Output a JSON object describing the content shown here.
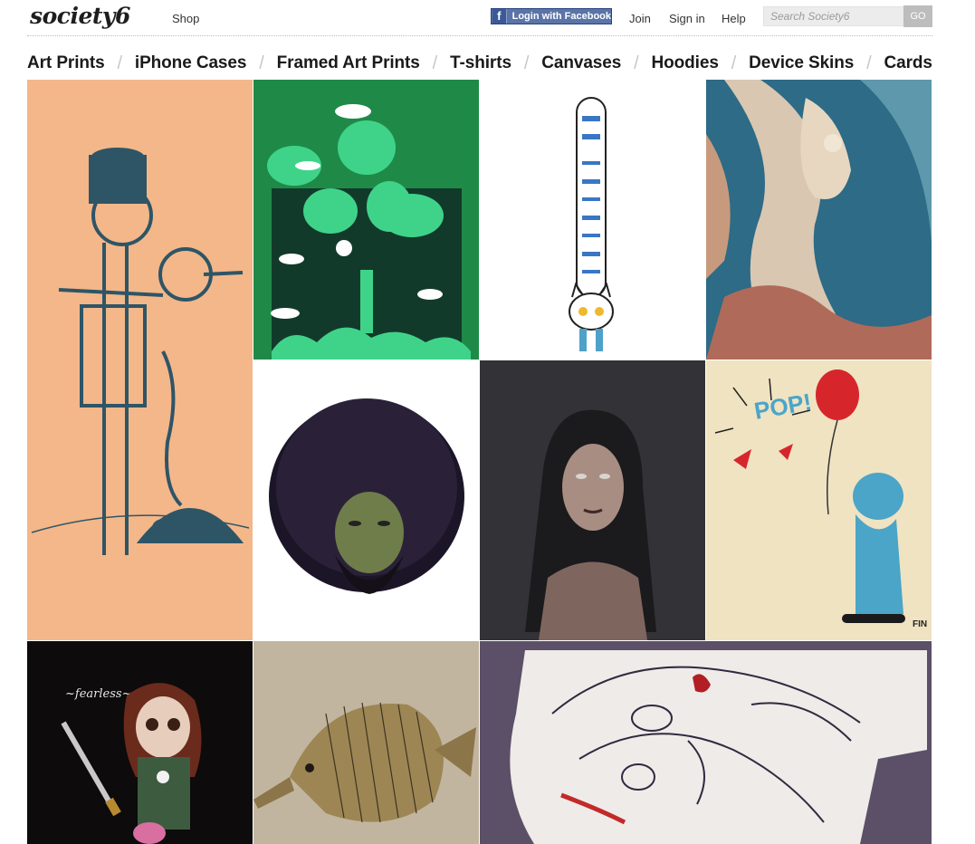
{
  "header": {
    "logo": "society6",
    "shop_label": "Shop",
    "facebook_login_label": "Login with Facebook",
    "links": [
      "Join",
      "Sign in",
      "Help"
    ],
    "search_placeholder": "Search Society6",
    "search_button": "GO"
  },
  "categories": [
    "Art Prints",
    "iPhone Cases",
    "Framed Art Prints",
    "T-shirts",
    "Canvases",
    "Hoodies",
    "Device Skins",
    "Cards"
  ],
  "artworks": {
    "fearless_caption": "~fearless~",
    "pop_caption": "POP!",
    "signature": "FIN"
  },
  "colors": {
    "facebook_blue": "#3b5998",
    "peach_bg": "#f3b78a",
    "green_bg": "#1f8a48",
    "purple_bg": "#5b5068"
  }
}
